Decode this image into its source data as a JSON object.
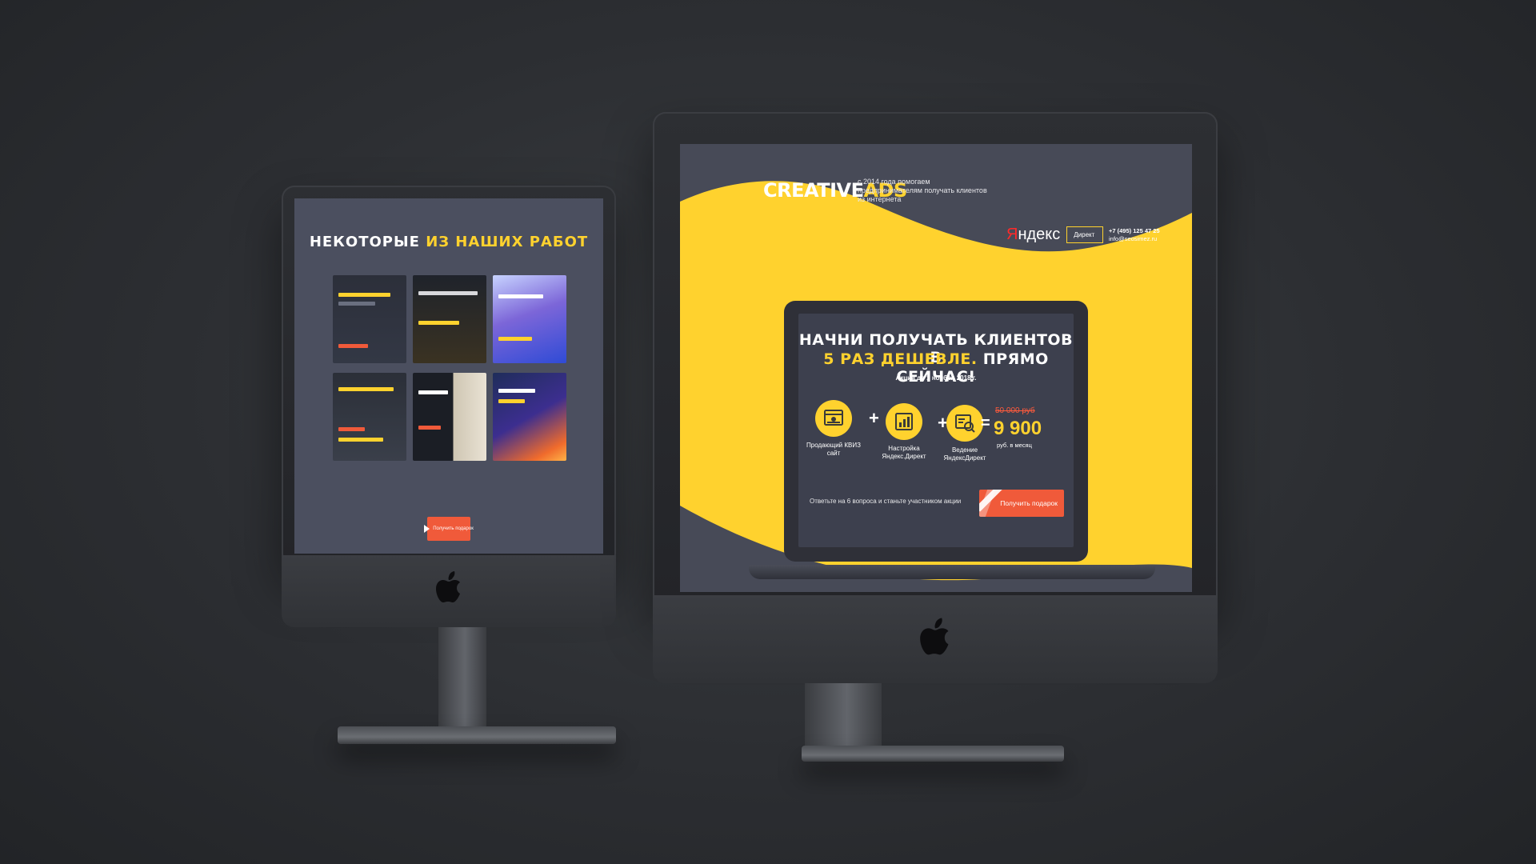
{
  "left_monitor": {
    "portfolio": {
      "title_prefix": "Некоторые",
      "title_highlight": "из наших работ",
      "cta_label": "Получить подарок"
    }
  },
  "right_monitor": {
    "header": {
      "logo_main": "CREATIVE",
      "logo_accent": "ADS",
      "tagline": "с 2014 года помогаем предпринимателям получать клиентов из интернета",
      "partner_name_prefix": "Я",
      "partner_name_rest": "ндекс",
      "partner_badge": "Директ",
      "phone": "+7 (495) 125 47 25",
      "email": "info@seosimez.ru"
    },
    "offer": {
      "headline_line1": "Начни получать клиентов в",
      "headline_highlight": "5 раз дешевле.",
      "headline_rest": " Прямо сейчас!",
      "promo_note": "Акция до 1 ноября 2018 г.",
      "services": [
        {
          "label": "Продающий КВИЗ сайт",
          "icon": "website-icon"
        },
        {
          "label": "Настройка Яндекс.Директ",
          "icon": "chart-icon"
        },
        {
          "label": "Ведение ЯндексДирект",
          "icon": "analytics-icon"
        }
      ],
      "operator_plus": "+",
      "operator_equals": "=",
      "old_price": "50 000 руб",
      "new_price": "9 900",
      "price_period": "руб. в месяц",
      "cta_text": "Ответьте на 6 вопроса и станьте участником акции",
      "cta_button": "Получить подарок"
    }
  },
  "colors": {
    "accent_yellow": "#ffd22e",
    "cta_red": "#f05a3a",
    "screen_bg": "#474a57"
  }
}
